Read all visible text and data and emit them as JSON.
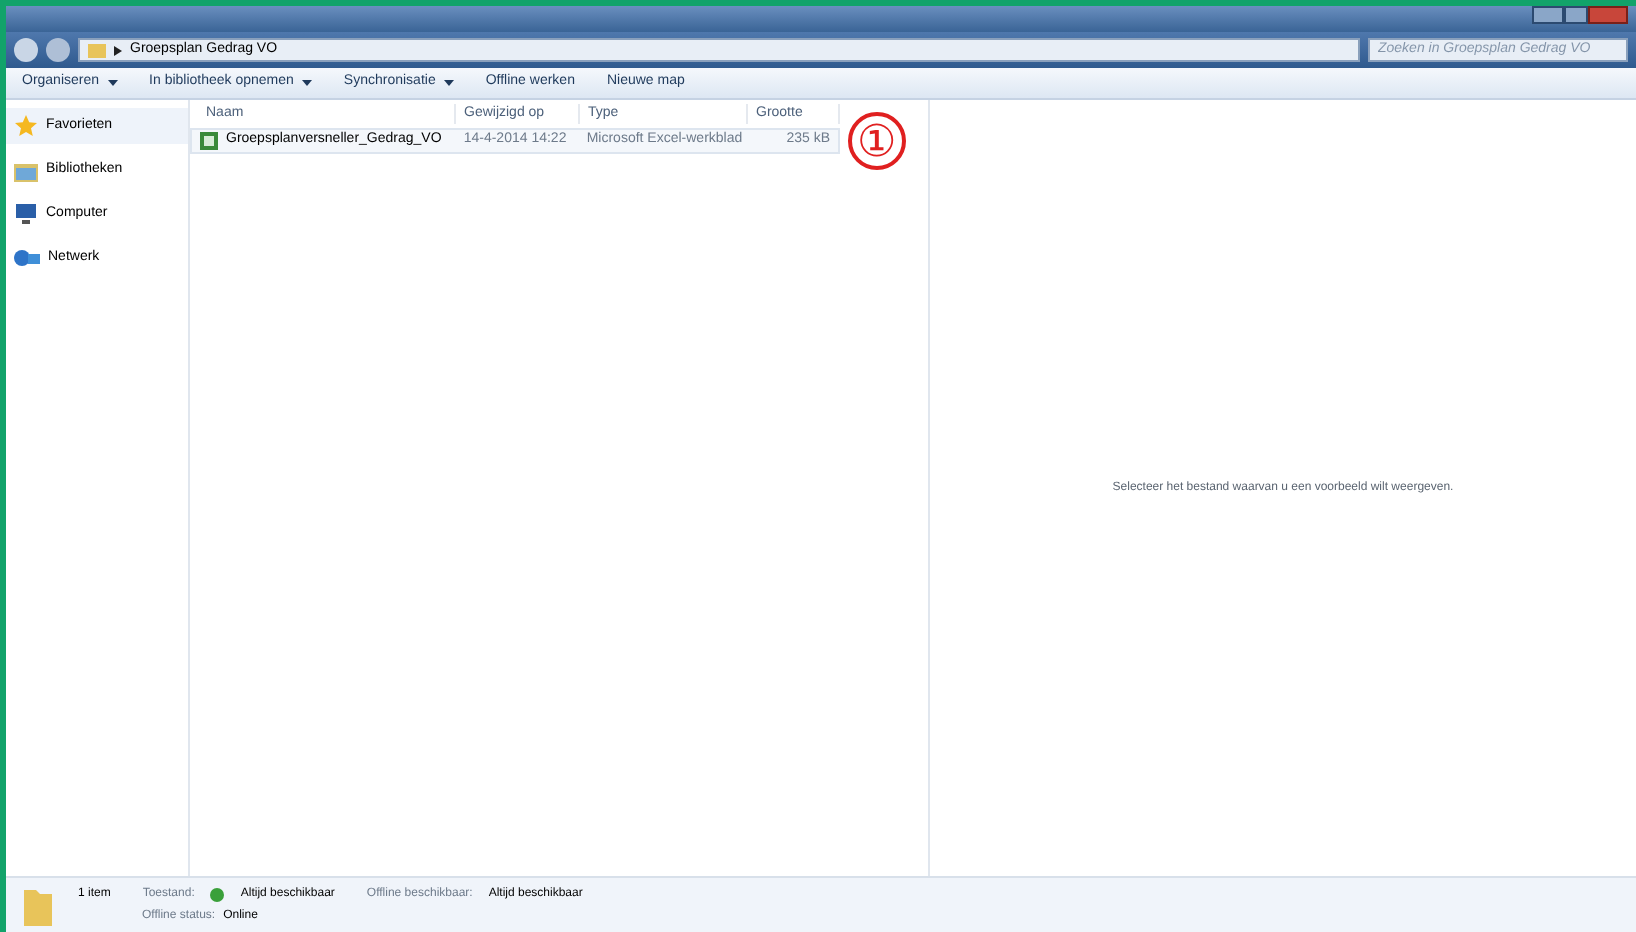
{
  "address_bar": {
    "path": "Groepsplan Gedrag VO",
    "search_placeholder": "Zoeken in Groepsplan Gedrag VO"
  },
  "toolbar": [
    {
      "label": "Organiseren",
      "dropdown": true
    },
    {
      "label": "In bibliotheek opnemen",
      "dropdown": true
    },
    {
      "label": "Synchronisatie",
      "dropdown": true
    },
    {
      "label": "Offline werken",
      "dropdown": false
    },
    {
      "label": "Nieuwe map",
      "dropdown": false
    }
  ],
  "sidebar": {
    "items": [
      {
        "label": "Favorieten",
        "kind": "star",
        "selected": true
      },
      {
        "label": "Bibliotheken",
        "kind": "library",
        "selected": false
      },
      {
        "label": "Computer",
        "kind": "computer",
        "selected": false
      },
      {
        "label": "Netwerk",
        "kind": "network",
        "selected": false
      }
    ]
  },
  "table": {
    "columns": [
      "Naam",
      "Gewijzigd op",
      "Type",
      "Grootte"
    ],
    "rows": [
      {
        "name": "Groepsplanversneller_Gedrag_VO",
        "modified": "14-4-2014 14:22",
        "type": "Microsoft Excel-werkblad",
        "size": "235 kB"
      }
    ]
  },
  "annotation": "①",
  "preview": {
    "message": "Selecteer het bestand waarvan u een voorbeeld wilt weergeven."
  },
  "status_bar": {
    "count": "1 item",
    "state_label": "Toestand:",
    "state_value": "Altijd beschikbaar",
    "offline_label": "Offline beschikbaar:",
    "offline_value": "Altijd beschikbaar",
    "status_label": "Offline status:",
    "status_value": "Online"
  }
}
